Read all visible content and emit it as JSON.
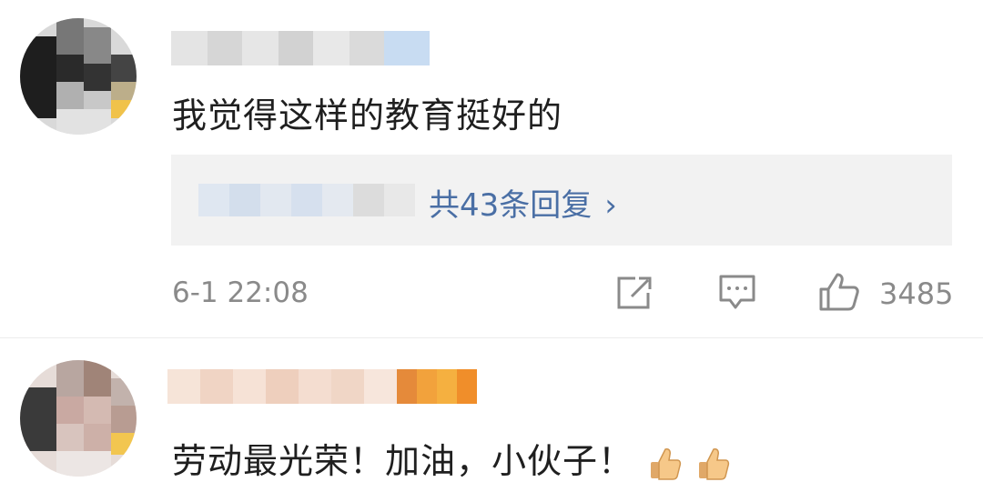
{
  "comments": [
    {
      "text": "我觉得这样的教育挺好的",
      "replies_link": "共43条回复",
      "chevron": "›",
      "timestamp": "6-1 22:08",
      "like_count": "3485",
      "icons": [
        "share-icon",
        "comment-icon",
        "like-icon"
      ]
    },
    {
      "text": "劳动最光荣！加油，小伙子！",
      "emoji": [
        "thumbs-up-emoji",
        "thumbs-up-emoji"
      ]
    }
  ],
  "colors": {
    "link": "#4a6fa5",
    "meta": "#8a8a8a",
    "reply_bg": "#f2f2f2",
    "divider": "#ececec"
  }
}
